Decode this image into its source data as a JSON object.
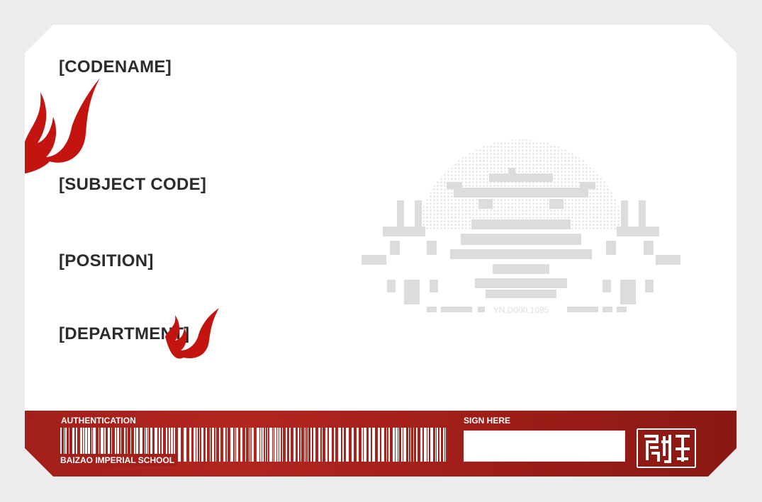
{
  "card": {
    "fields": {
      "codename": "[CODENAME]",
      "subject_code": "[SUBJECT CODE]",
      "position": "[POSITION]",
      "department": "[DEPARTMENT]"
    },
    "emblem_text": "YN.D000.1095"
  },
  "footer": {
    "authentication_label": "AUTHENTICATION",
    "school_name": "BAIZAO IMPERIAL SCHOOL",
    "sign_label": "SIGN HERE",
    "sign_value": ""
  },
  "colors": {
    "accent": "#a31f19",
    "flame": "#c41410",
    "emblem": "#dcdcdc",
    "background": "#ececec",
    "card": "#ffffff"
  },
  "icons": {
    "flame": "flame-icon",
    "emblem": "palace-emblem-icon",
    "seal": "seal-stamp-icon",
    "barcode": "barcode-icon"
  }
}
